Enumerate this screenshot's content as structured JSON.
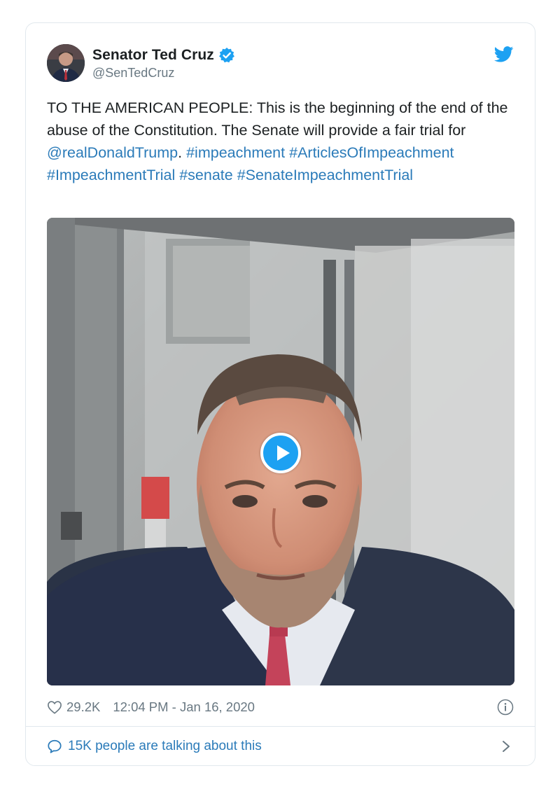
{
  "author": {
    "name": "Senator Ted Cruz",
    "handle": "@SenTedCruz",
    "verified_icon": "verified-badge-icon",
    "avatar_icon": "avatar-photo"
  },
  "brand": {
    "icon": "twitter-bird-icon",
    "color": "#1da1f2"
  },
  "tweet": {
    "text_before": "TO THE AMERICAN PEOPLE: This is the beginning of the end of the abuse of the Constitution. The Senate will provide a fair trial for ",
    "mention": "@realDonaldTrump",
    "text_after": ". ",
    "hashtags": [
      "#impeachment",
      "#ArticlesOfImpeachment",
      "#ImpeachmentTrial",
      "#senate",
      "#SenateImpeachmentTrial"
    ]
  },
  "media": {
    "type": "video",
    "play_icon": "play-icon"
  },
  "meta": {
    "likes": "29.2K",
    "timestamp": "12:04 PM - Jan 16, 2020",
    "heart_icon": "heart-icon",
    "info_icon": "info-icon"
  },
  "conversation": {
    "label": "15K people are talking about this",
    "bubble_icon": "speech-bubble-icon",
    "chevron_icon": "chevron-right-icon"
  },
  "colors": {
    "link": "#2b7bb9",
    "muted": "#697882",
    "text": "#1c2022",
    "border": "#e1e8ed"
  }
}
